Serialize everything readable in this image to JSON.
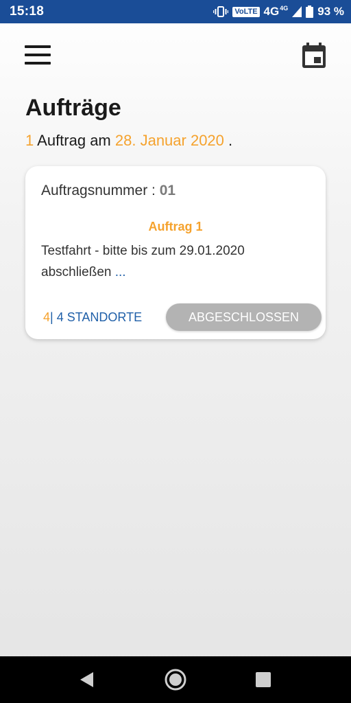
{
  "status_bar": {
    "time": "15:18",
    "volte": "VoLTE",
    "network": "4G",
    "network_sup": "4G",
    "battery": "93 %"
  },
  "icons": {
    "menu": "hamburger-menu-icon",
    "calendar": "calendar-icon",
    "vibrate": "vibrate-icon",
    "signal": "signal-icon",
    "battery": "battery-icon",
    "back": "back-triangle-icon",
    "home": "home-circle-icon",
    "recents": "recents-square-icon"
  },
  "page": {
    "title": "Aufträge",
    "summary_count": "1",
    "summary_text": "Auftrag am",
    "summary_date": "28. Januar 2020",
    "summary_end": "."
  },
  "card": {
    "order_number_label": "Auftragsnummer :",
    "order_number_value": "01",
    "title": "Auftrag 1",
    "description": "Testfahrt - bitte bis zum 29.01.2020 abschließen",
    "more": "...",
    "locations_done": "4",
    "locations_sep": "|",
    "locations_label": "4 STANDORTE",
    "status_button": "ABGESCHLOSSEN"
  },
  "colors": {
    "status_bar": "#1a4d97",
    "accent_orange": "#f5a22d",
    "link_blue": "#1f5fa8",
    "button_gray": "#b3b3b3"
  }
}
